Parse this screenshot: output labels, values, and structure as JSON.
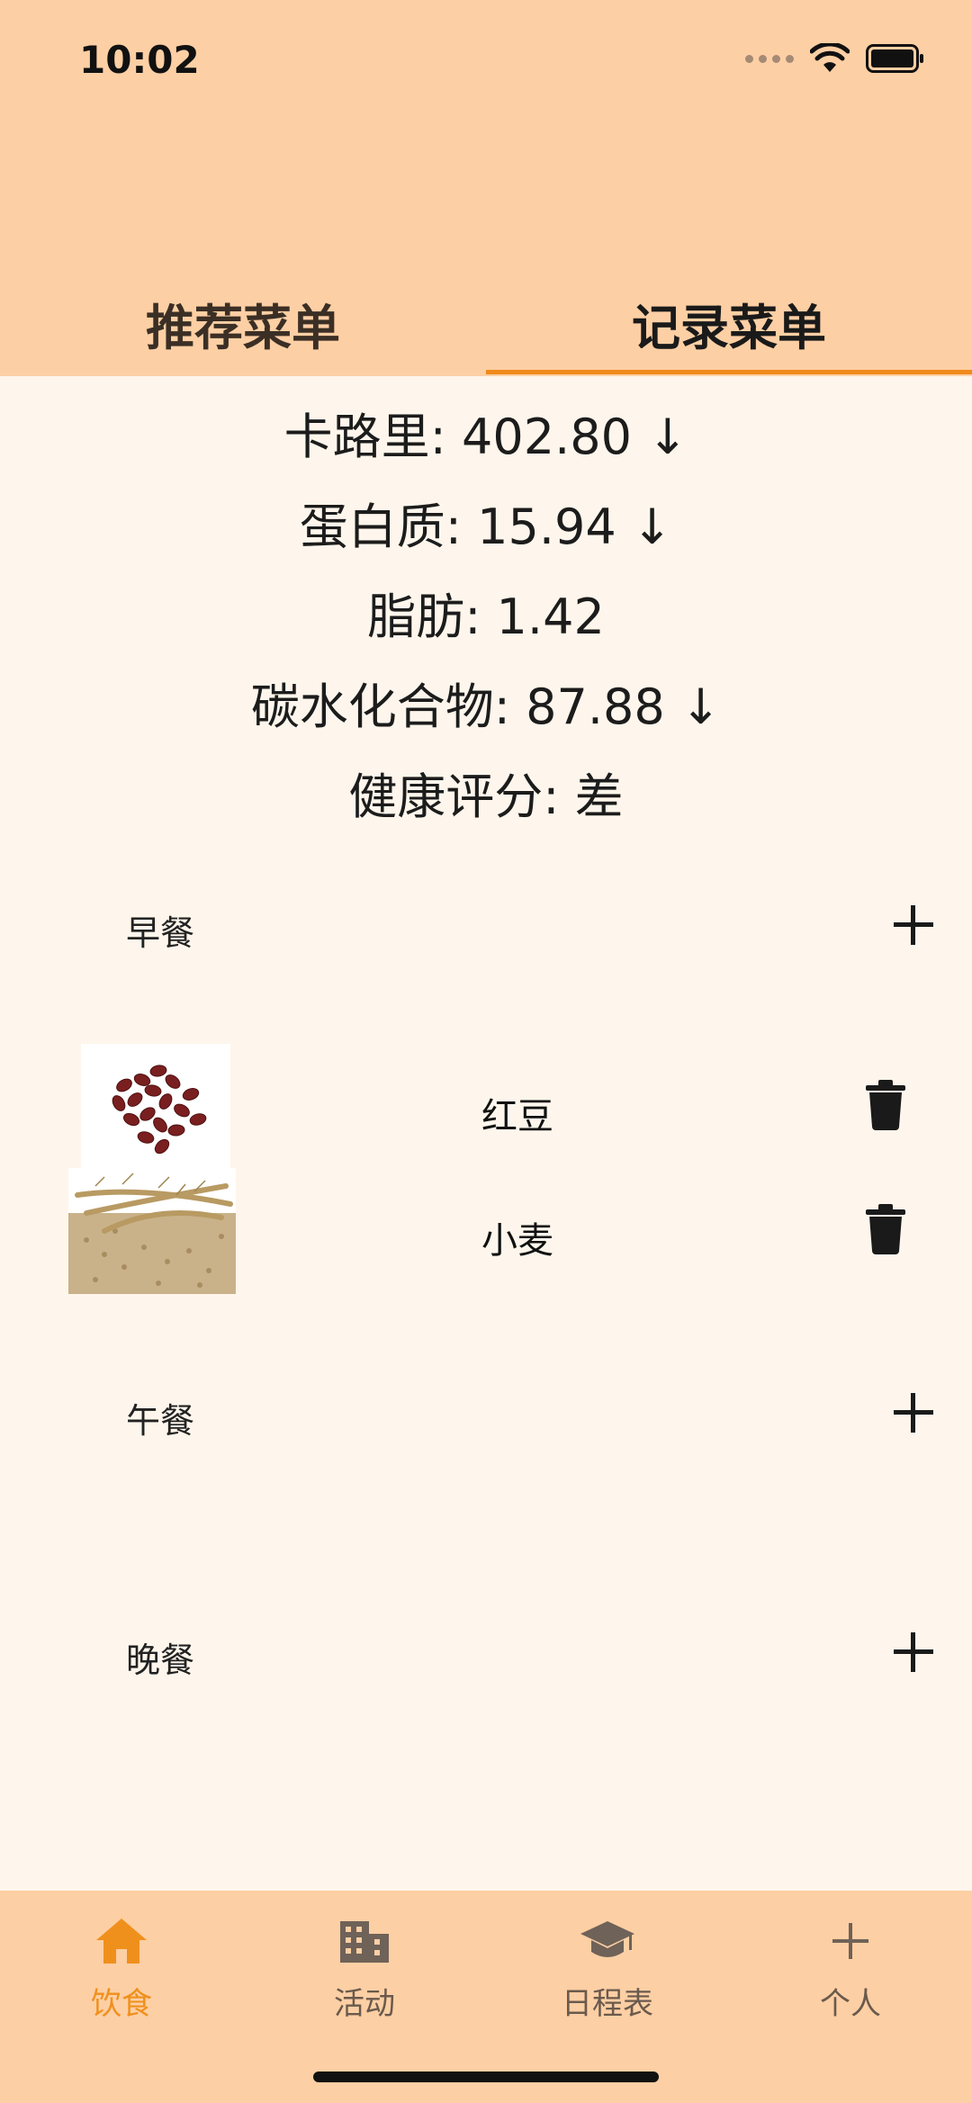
{
  "status_bar": {
    "time": "10:02"
  },
  "tabs": {
    "recommended": "推荐菜单",
    "records": "记录菜单",
    "active": "records"
  },
  "summary": [
    {
      "label": "卡路里: 402.80 ↓"
    },
    {
      "label": "蛋白质: 15.94 ↓"
    },
    {
      "label": "脂肪: 1.42"
    },
    {
      "label": "碳水化合物: 87.88 ↓"
    },
    {
      "label": "健康评分: 差"
    }
  ],
  "meals": {
    "breakfast": {
      "title": "早餐",
      "items": [
        {
          "name": "红豆",
          "image": "red-bean-image"
        },
        {
          "name": "小麦",
          "image": "wheat-image"
        }
      ]
    },
    "lunch": {
      "title": "午餐",
      "items": []
    },
    "dinner": {
      "title": "晚餐",
      "items": []
    }
  },
  "bottom_nav": [
    {
      "label": "饮食",
      "icon": "home-icon",
      "active": true
    },
    {
      "label": "活动",
      "icon": "building-icon",
      "active": false
    },
    {
      "label": "日程表",
      "icon": "graduation-cap-icon",
      "active": false
    },
    {
      "label": "个人",
      "icon": "plus-icon",
      "active": false
    }
  ],
  "colors": {
    "accent": "#f0901c",
    "header_bg": "#fdcfa4",
    "page_bg": "#fef6ec"
  }
}
